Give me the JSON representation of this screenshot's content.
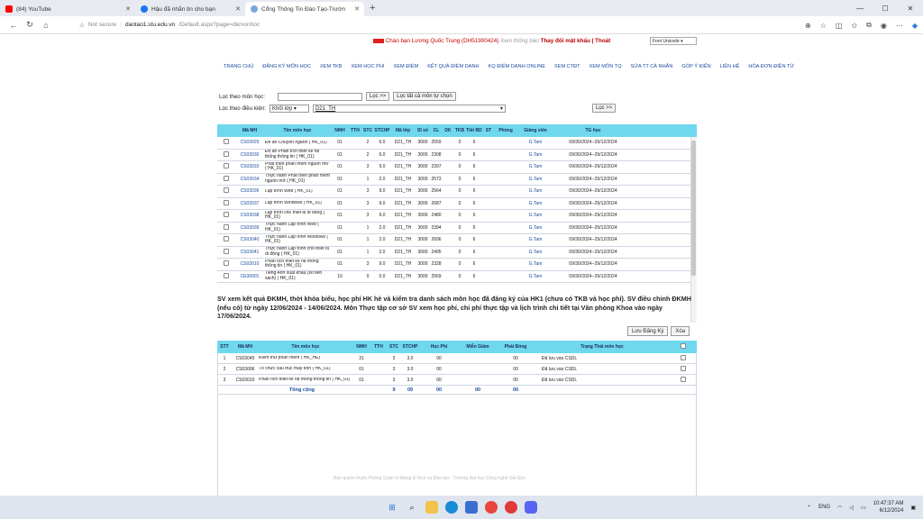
{
  "browser": {
    "tabs": [
      {
        "label": "(84) YouTube",
        "color": "#ff0000"
      },
      {
        "label": "Hậu đã nhắn tin cho bạn",
        "color": "#1877f2"
      },
      {
        "label": "Cổng Thông Tin Đào Tạo-Trườn",
        "color": "#7aa7d8"
      }
    ],
    "new_tab": "+",
    "url_secure": "Not secure",
    "url_host": "daotao1.stu.edu.vn",
    "url_path": "/Default.aspx?page=dkmonhoc"
  },
  "header": {
    "greeting": "Chào bạn Lương Quốc Trung (DH51900424)",
    "notice_link": "Xem thông báo",
    "account_links": "Thay đổi mật khẩu | Thoát",
    "language": "Font Unicode"
  },
  "nav": {
    "items": [
      "TRANG CHỦ",
      "ĐĂNG KÝ MÔN HỌC",
      "XEM TKB",
      "XEM HỌC PHÍ",
      "XEM ĐIỂM",
      "KẾT QUẢ ĐIỂM DANH",
      "KQ ĐIỂM DANH ONLINE",
      "XEM CTĐT",
      "XEM MÔN TQ",
      "SỬA TT CÁ NHÂN",
      "GÓP Ý KIẾN",
      "LIÊN HỆ",
      "HÓA ĐƠN ĐIỆN TỬ"
    ]
  },
  "filter": {
    "by_subject_label": "Lọc theo môn học:",
    "by_subject_button": "Lọc >>",
    "all_subjects_button": "Lọc tất cả môn tự chọn",
    "by_condition_label": "Lọc theo điều kiện:",
    "condition_select": "Khối lớp",
    "class_select": "D21_TH",
    "condition_button": "Lọc >>"
  },
  "courses_table": {
    "headers": [
      "",
      "Mã MH",
      "Tên môn học",
      "NMH",
      "TTH",
      "STC",
      "STCHP",
      "Mã lớp",
      "Sĩ số",
      "CL",
      "DK",
      "TKB",
      "Tiết BD",
      "ST",
      "Phòng",
      "Giảng viên",
      "TG học"
    ],
    "rows": [
      [
        "",
        "CS03029",
        "Đồ án Chuyên ngành ( HK_01)",
        "01",
        "",
        "2",
        "6.0",
        "D21_TH",
        "3000",
        "2559",
        "",
        "0",
        "6",
        "",
        "",
        "G.Tam",
        "09/30/2024--29/12/2024"
      ],
      [
        "",
        "CS03030",
        "Đồ án Phân tích thiết kế hệ thống thông tin ( HK_01)",
        "01",
        "",
        "2",
        "6.0",
        "D21_TH",
        "3000",
        "2308",
        "",
        "0",
        "6",
        "",
        "",
        "G.Tam",
        "09/30/2024--29/12/2024"
      ],
      [
        "",
        "CS03033",
        "Phát triển phần mềm nguồn mở ( HK_01)",
        "01",
        "",
        "3",
        "9.0",
        "D21_TH",
        "3000",
        "2397",
        "",
        "0",
        "6",
        "",
        "",
        "G.Tam",
        "09/30/2024--29/12/2024"
      ],
      [
        "",
        "CS03034",
        "Thực hành Phát triển phần mềm nguồn mở ( HK_01)",
        "01",
        "",
        "1",
        "2.0",
        "D21_TH",
        "3000",
        "2573",
        "",
        "0",
        "6",
        "",
        "",
        "G.Tam",
        "09/30/2024--29/12/2024"
      ],
      [
        "",
        "CS03036",
        "Lập trình Web ( HK_01)",
        "01",
        "",
        "3",
        "9.0",
        "D21_TH",
        "3000",
        "2564",
        "",
        "0",
        "6",
        "",
        "",
        "G.Tam",
        "09/30/2024--29/12/2024"
      ],
      [
        "",
        "CS03037",
        "Lập trình Windows ( HK_01)",
        "01",
        "",
        "3",
        "9.0",
        "D21_TH",
        "3000",
        "2687",
        "",
        "0",
        "6",
        "",
        "",
        "G.Tam",
        "09/30/2024--29/12/2024"
      ],
      [
        "",
        "CS03038",
        "Lập trình cho thiết bị di động ( HK_01)",
        "01",
        "",
        "3",
        "9.0",
        "D21_TH",
        "3000",
        "2480",
        "",
        "0",
        "6",
        "",
        "",
        "G.Tam",
        "09/30/2024--29/12/2024"
      ],
      [
        "",
        "CS03039",
        "Thực hành Lập trình Web ( HK_01)",
        "01",
        "",
        "1",
        "2.0",
        "D21_TH",
        "3000",
        "2394",
        "",
        "0",
        "6",
        "",
        "",
        "G.Tam",
        "09/30/2024--29/12/2024"
      ],
      [
        "",
        "CS03040",
        "Thực hành Lập trình Windows ( HK_01)",
        "01",
        "",
        "1",
        "2.0",
        "D21_TH",
        "3000",
        "2606",
        "",
        "0",
        "6",
        "",
        "",
        "G.Tam",
        "09/30/2024--29/12/2024"
      ],
      [
        "",
        "CS03041",
        "Thực hành Lập trình cho thiết bị di động ( HK_01)",
        "01",
        "",
        "1",
        "2.0",
        "D21_TH",
        "3000",
        "2405",
        "",
        "0",
        "6",
        "",
        "",
        "G.Tam",
        "09/30/2024--29/12/2024"
      ],
      [
        "",
        "CS03010",
        "Phân tích thiết kế hệ thống thông tin ( HK_01)",
        "01",
        "",
        "3",
        "9.0",
        "D21_TH",
        "3000",
        "2328",
        "",
        "0",
        "6",
        "",
        "",
        "G.Tam",
        "09/30/2024--29/12/2024"
      ],
      [
        "",
        "CE00001",
        "Tiếng Anh xuất khẩu (số tiền sách) ( HK_01)",
        "10",
        "",
        "0",
        "0.0",
        "D21_TH",
        "3000",
        "2569",
        "",
        "0",
        "6",
        "",
        "",
        "G.Tam",
        "09/30/2024--29/12/2024"
      ]
    ]
  },
  "notice": "SV xem kết quả ĐKMH, thời khóa biểu, học phí HK hè và kiểm tra danh sách môn học đã đăng ký của HK1 (chưa có TKB và học phí). SV điều chỉnh ĐKMH (nếu có) từ ngày 12/06/2024 - 14/06/2024. Môn Thực tập cơ sở SV xem học phí, chi phí thực tập và lịch trình chi tiết tại Văn phòng Khoa vào ngày 17/06/2024.",
  "actions": {
    "save": "Lưu Đăng Ký",
    "delete": "Xóa"
  },
  "registered_table": {
    "headers": [
      "STT",
      "Mã MH",
      "Tên môn học",
      "NMH",
      "TTH",
      "STC",
      "STCHP",
      "Học Phí",
      "Miễn Giảm",
      "Phải Đóng",
      "Trạng Thái môn học",
      ""
    ],
    "rows": [
      [
        "1",
        "CS03045",
        "Kiểm thử phần mềm ( HK_HÈ)",
        "31",
        "",
        "3",
        "3.0",
        "00",
        "",
        "00",
        "Đã lưu vào CSDL"
      ],
      [
        "2",
        "CS03006",
        "Tổ chức cấu trúc máy tính ( HK_01)",
        "01",
        "",
        "3",
        "3.0",
        "00",
        "",
        "00",
        "Đã lưu vào CSDL"
      ],
      [
        "3",
        "CS03010",
        "Phân tích thiết kế hệ thống thông tin ( HK_01)",
        "01",
        "",
        "3",
        "3.0",
        "00",
        "",
        "00",
        "Đã lưu vào CSDL"
      ]
    ],
    "total_label": "Tổng cộng",
    "total_stc": "9",
    "total_stchp": "09",
    "total_fee": "00",
    "total_discount": "00",
    "total_due": "00"
  },
  "footer": "Bản quyền thuộc Phòng Quản trị Mạng & Dịch vụ Đào tạo - Trường Đại học Công nghệ Sài Gòn",
  "taskbar": {
    "lang": "ENG",
    "time": "10:47:37 AM",
    "date": "6/12/2024"
  }
}
